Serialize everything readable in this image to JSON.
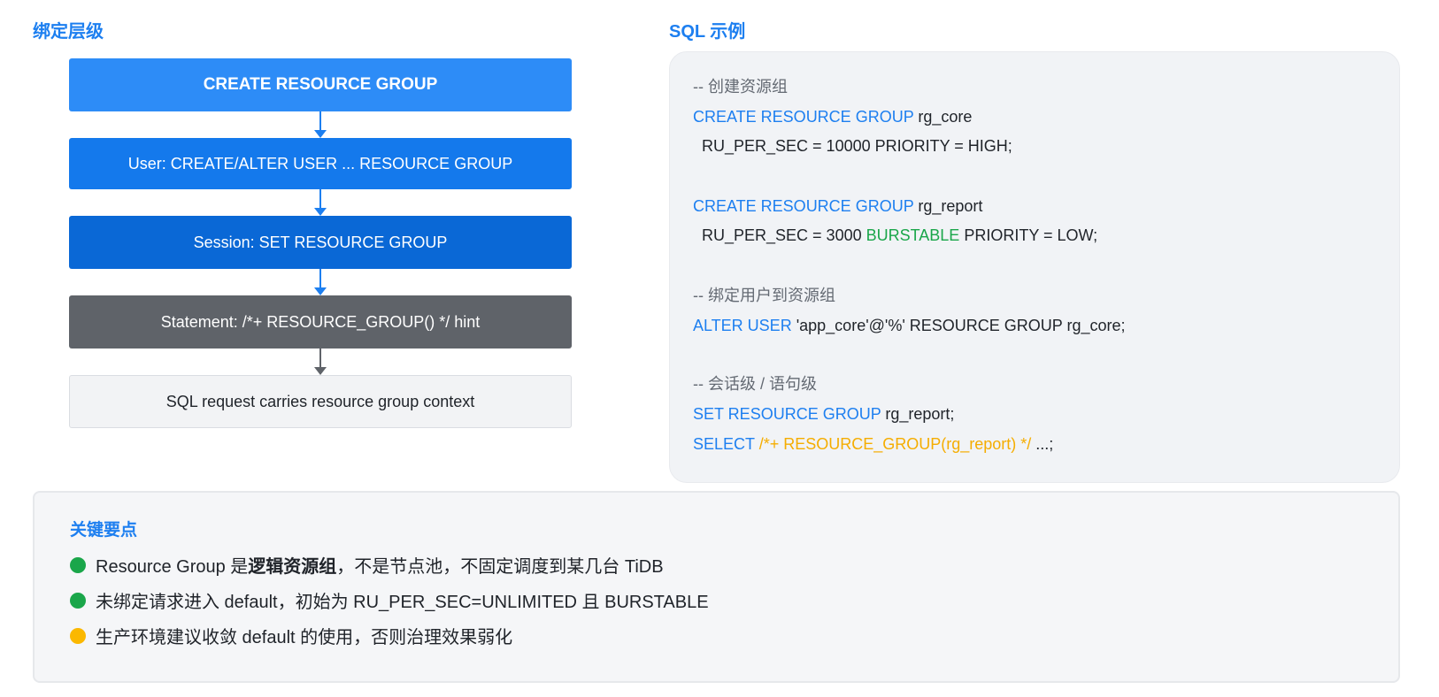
{
  "left": {
    "title": "绑定层级",
    "flow": [
      "CREATE RESOURCE GROUP",
      "User: CREATE/ALTER USER ... RESOURCE GROUP",
      "Session: SET RESOURCE GROUP",
      "Statement: /*+ RESOURCE_GROUP() */ hint",
      "SQL request carries resource group context"
    ]
  },
  "right": {
    "title": "SQL 示例",
    "code": {
      "c1": "-- 创建资源组",
      "l1_kw": "CREATE RESOURCE GROUP",
      "l1_rest": " rg_core",
      "l2": "  RU_PER_SEC = 10000 PRIORITY = HIGH;",
      "l3_kw": "CREATE RESOURCE GROUP",
      "l3_rest": " rg_report",
      "l4_a": "  RU_PER_SEC = 3000 ",
      "l4_green": "BURSTABLE",
      "l4_b": " PRIORITY = LOW;",
      "c2": "-- 绑定用户到资源组",
      "l5_kw": "ALTER USER",
      "l5_rest": " 'app_core'@'%' RESOURCE GROUP rg_core;",
      "c3": "-- 会话级 / 语句级",
      "l6_kw": "SET RESOURCE GROUP",
      "l6_rest": " rg_report;",
      "l7_kw": "SELECT",
      "l7_hint": " /*+ RESOURCE_GROUP(rg_report) */",
      "l7_rest": " ...;"
    }
  },
  "points": {
    "title": "关键要点",
    "items": [
      {
        "pre": "Resource Group 是",
        "bold": "逻辑资源组",
        "post": "，不是节点池，不固定调度到某几台 TiDB",
        "color": "#1aa64a"
      },
      {
        "pre": "未绑定请求进入 default，初始为 RU_PER_SEC=UNLIMITED 且 BURSTABLE",
        "bold": "",
        "post": "",
        "color": "#1aa64a"
      },
      {
        "pre": "生产环境建议收敛 default 的使用，否则治理效果弱化",
        "bold": "",
        "post": "",
        "color": "#fbb800"
      }
    ]
  }
}
